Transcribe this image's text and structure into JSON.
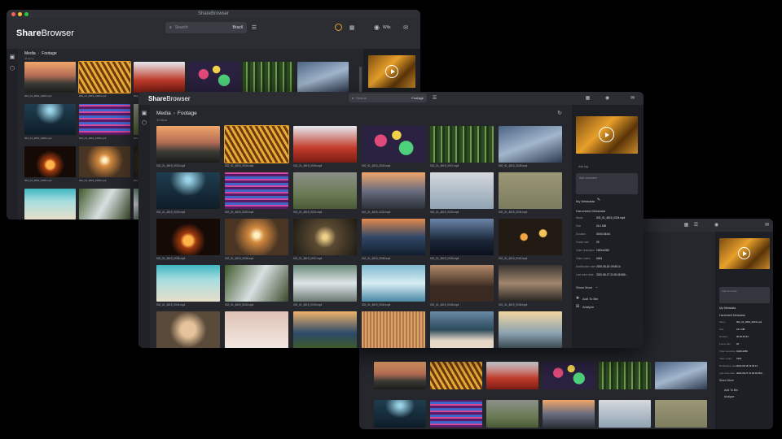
{
  "app": {
    "window_title": "ShareBrowser",
    "logo_bold": "Share",
    "logo_rest": "Browser"
  },
  "header": {
    "search_placeholder": "Search",
    "search_scope_a": "Brazil",
    "search_scope_b": "Footage",
    "user": "Wils"
  },
  "breadcrumb": {
    "root": "Media",
    "sep": "›",
    "current": "Footage",
    "count": "34 items"
  },
  "files": [
    "002_01_4819_0023.mp4",
    "002_01_4819_0024.mp4",
    "002_01_4819_0025.mp4",
    "002_01_4819_0026.mp4",
    "002_01_4819_0027.mp4",
    "002_01_4819_0028.mp4",
    "002_01_4819_0029.mp4",
    "002_01_4819_0030.mp4",
    "002_01_4819_0031.mp4",
    "002_01_4819_0032.mp4",
    "002_01_4819_0033.mp4",
    "002_01_4819_0034.mp4",
    "002_01_4819_0035.mp4",
    "002_01_4819_0036.mp4",
    "002_01_4819_0037.mp4",
    "002_01_4819_0038.mp4",
    "002_01_4819_0039.mp4",
    "002_01_4819_0040.mp4",
    "002_01_4819_0041.mp4",
    "002_01_4819_0042.mp4",
    "002_01_4819_0043.mp4",
    "002_01_4819_0044.mp4",
    "002_01_4819_0045.mp4",
    "002_01_4819_0046.mp4"
  ],
  "panel": {
    "add_tag": "Add tag",
    "add_comment": "Add comment",
    "my_metadata": "My Metadata",
    "harvested": "Harvested Metadata",
    "meta": [
      {
        "k": "Name",
        "v": "002_01_4819_0024.mp4"
      },
      {
        "k": "Size",
        "v": "24.1 MB"
      },
      {
        "k": "Duration",
        "v": "00:00:45.64"
      },
      {
        "k": "Frame rate",
        "v": "29"
      },
      {
        "k": "Video resolution",
        "v": "1920x1080"
      },
      {
        "k": "Video codec",
        "v": "h264"
      },
      {
        "k": "Modification date",
        "v": "2020-08-18 19:05:14"
      },
      {
        "k": "Last index date",
        "v": "2020-08-27 21:00:46.560..."
      }
    ],
    "show_more": "Show More",
    "add_to_bin": "Add To Bin",
    "analyze": "Analyze"
  },
  "colors": {
    "accent": "#e8a02b",
    "bg": "#25272d",
    "panel": "#1d1f24"
  }
}
